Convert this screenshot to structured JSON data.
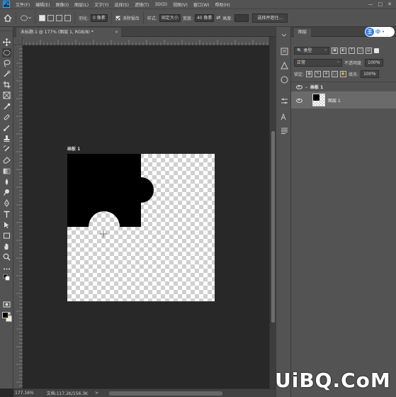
{
  "menubar": {
    "logo": "Ps",
    "items": [
      "文件(F)",
      "编辑(E)",
      "图像(I)",
      "图层(L)",
      "文字(Y)",
      "选择(S)",
      "滤镜(T)",
      "3D(D)",
      "视图(V)",
      "窗口(W)",
      "帮助(H)"
    ],
    "window_controls": [
      "—",
      "□",
      "✕"
    ]
  },
  "options": {
    "feather_label": "羽化:",
    "feather_value": "0 像素",
    "antialias_label": "消除锯齿",
    "style_label": "样式:",
    "style_value": "固定大小",
    "width_label": "宽度:",
    "width_value": "40 像素",
    "height_label": "高度:",
    "select_mask_button": "选择并遮住..."
  },
  "document": {
    "tab_title": "未标题-1 @ 177% (图层 1, RGB/8) *",
    "close_glyph": "×",
    "artboard_label": "画板 1"
  },
  "status": {
    "zoom": "177.16%",
    "doc_info": "文档:117.2K/156.3K",
    "arrow": ">"
  },
  "layers_panel": {
    "tab_label": "图层",
    "ime_label": "中",
    "ime_dot": "•",
    "filter_kind": "类型",
    "blend_mode": "正常",
    "opacity_label": "不透明度:",
    "opacity_value": "100%",
    "lock_label": "锁定:",
    "fill_label": "填充:",
    "fill_value": "100%",
    "group_name": "画板 1",
    "layer_name": "图层 1"
  },
  "toolbar": {
    "tools": [
      "move-tool",
      "marquee-tool",
      "lasso-tool",
      "quick-select-tool",
      "crop-tool",
      "frame-tool",
      "eyedropper-tool",
      "healing-brush-tool",
      "brush-tool",
      "clone-stamp-tool",
      "history-brush-tool",
      "eraser-tool",
      "gradient-tool",
      "blur-tool",
      "dodge-tool",
      "pen-tool",
      "type-tool",
      "path-select-tool",
      "rectangle-tool",
      "hand-tool",
      "zoom-tool",
      "more-tools"
    ],
    "active_tool": "marquee-tool"
  },
  "colors": {
    "foreground": "#000000",
    "background": "#f3efc7",
    "accent": "#31a8ff"
  },
  "watermark": "UiBQ.CoM"
}
